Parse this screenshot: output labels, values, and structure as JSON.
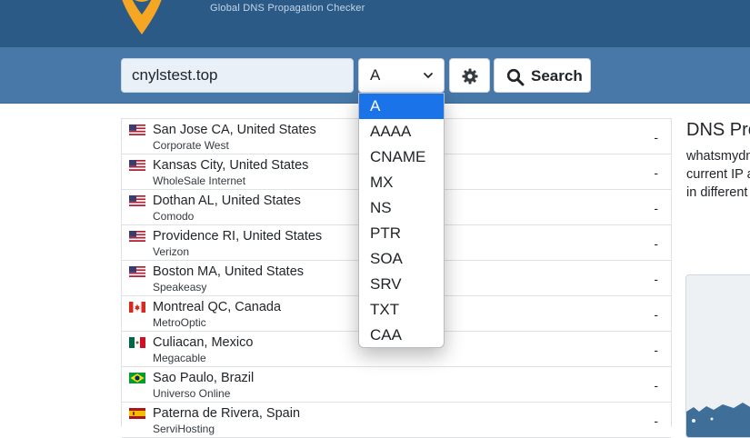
{
  "header": {
    "tagline": "Global DNS Propagation Checker",
    "brand_color": "#2b5a87"
  },
  "search": {
    "domain_value": "cnylstest.top",
    "record_type": "A",
    "settings_icon": "gear-icon",
    "search_label": "Search",
    "search_icon": "magnifier-icon",
    "bar_color": "#4778a8"
  },
  "dropdown": {
    "options": [
      "A",
      "AAAA",
      "CNAME",
      "MX",
      "NS",
      "PTR",
      "SOA",
      "SRV",
      "TXT",
      "CAA"
    ],
    "selected": "A",
    "highlight_color": "#1a73e8"
  },
  "results": [
    {
      "location": "San Jose CA, United States",
      "provider": "Corporate West",
      "flag": "us",
      "result": "-"
    },
    {
      "location": "Kansas City, United States",
      "provider": "WholeSale Internet",
      "flag": "us",
      "result": "-"
    },
    {
      "location": "Dothan AL, United States",
      "provider": "Comodo",
      "flag": "us",
      "result": "-"
    },
    {
      "location": "Providence RI, United States",
      "provider": "Verizon",
      "flag": "us",
      "result": "-"
    },
    {
      "location": "Boston MA, United States",
      "provider": "Speakeasy",
      "flag": "us",
      "result": "-"
    },
    {
      "location": "Montreal QC, Canada",
      "provider": "MetroOptic",
      "flag": "ca",
      "result": "-"
    },
    {
      "location": "Culiacan, Mexico",
      "provider": "Megacable",
      "flag": "mx",
      "result": "-"
    },
    {
      "location": "Sao Paulo, Brazil",
      "provider": "Universo Online",
      "flag": "br",
      "result": "-"
    },
    {
      "location": "Paterna de Rivera, Spain",
      "provider": "ServiHosting",
      "flag": "es",
      "result": "-"
    }
  ],
  "sidebar": {
    "title": "DNS Pro",
    "lines": [
      "whatsmydn",
      "current IP a",
      "in different"
    ]
  }
}
